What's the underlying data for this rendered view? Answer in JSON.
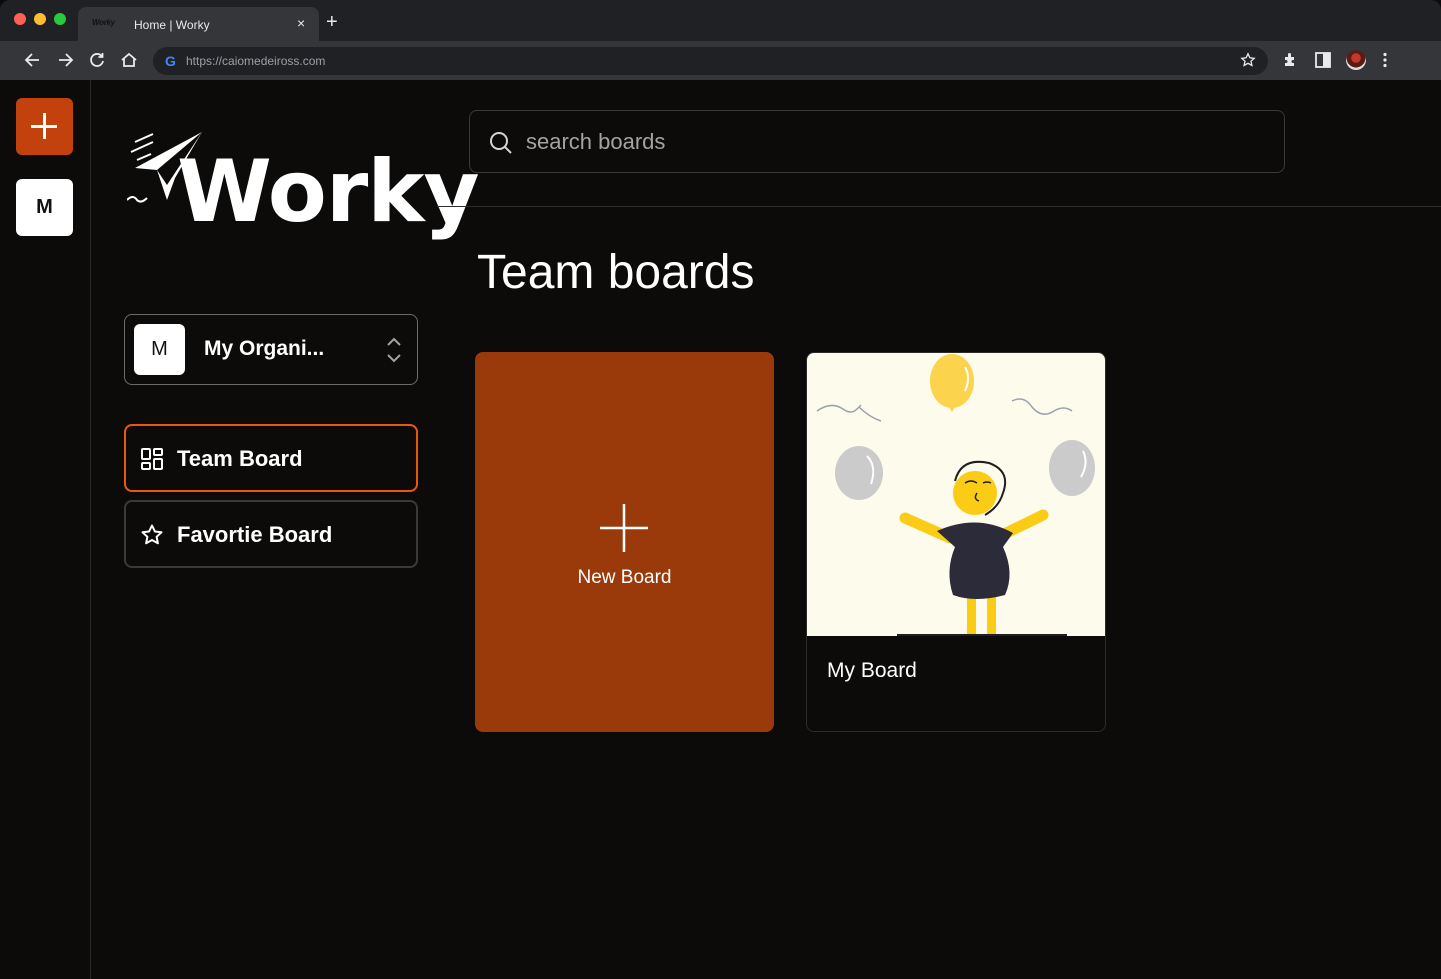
{
  "browser": {
    "tab_favicon_text": "Worky",
    "tab_title": "Home | Worky",
    "tab_close": "×",
    "new_tab": "+",
    "url": "https://caiomedeiross.com",
    "google_icon": "G"
  },
  "rail": {
    "add_icon": "plus-icon",
    "org_initial": "M"
  },
  "sidebar": {
    "logo_text": "Worky",
    "org": {
      "initial": "M",
      "name": "My Organi..."
    },
    "nav": [
      {
        "label": "Team Board",
        "icon": "grid-icon",
        "active": true
      },
      {
        "label": "Favortie Board",
        "icon": "star-icon",
        "active": false
      }
    ]
  },
  "main": {
    "search_placeholder": "search boards",
    "title": "Team boards",
    "new_board_label": "New Board",
    "boards": [
      {
        "name": "My Board"
      }
    ]
  },
  "colors": {
    "accent": "#ea580c",
    "new_board_bg": "#9a3a0b",
    "rail_add_bg": "#c2410c",
    "background": "#0c0b0a"
  }
}
